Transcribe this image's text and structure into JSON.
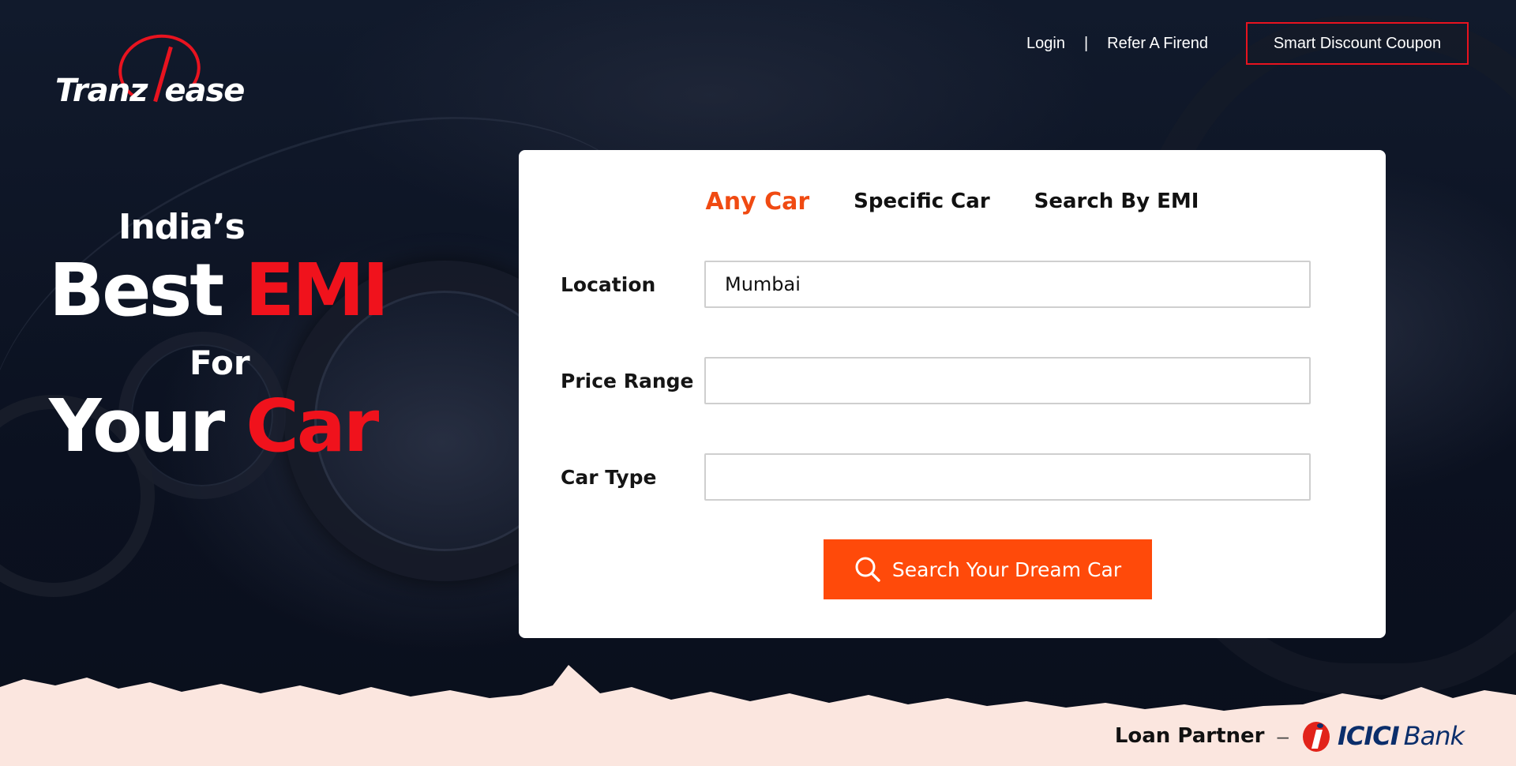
{
  "brand": {
    "logo_left": "Tranz",
    "logo_right": "ease"
  },
  "nav": {
    "login": "Login",
    "separator": "|",
    "refer": "Refer A Firend",
    "coupon": "Smart Discount Coupon"
  },
  "headline": {
    "line1": "India’s",
    "line2_a": "Best ",
    "line2_b": "EMI",
    "line3": "For",
    "line4_a": "Your ",
    "line4_b": "Car"
  },
  "search": {
    "tabs": [
      {
        "label": "Any Car",
        "active": true
      },
      {
        "label": "Specific Car",
        "active": false
      },
      {
        "label": "Search By EMI",
        "active": false
      }
    ],
    "fields": {
      "location": {
        "label": "Location",
        "value": "Mumbai"
      },
      "price": {
        "label": "Price Range",
        "value": ""
      },
      "type": {
        "label": "Car Type",
        "value": ""
      }
    },
    "button": "Search Your Dream Car",
    "button_icon": "search-icon"
  },
  "partner": {
    "label": "Loan Partner",
    "dash": "–",
    "bank_a": "ICICI",
    "bank_b": "Bank"
  },
  "colors": {
    "accent": "#ff4a0a",
    "brand_red": "#e8131f",
    "bank_blue": "#0b2e6b",
    "footer_bg": "#fbe6df"
  }
}
